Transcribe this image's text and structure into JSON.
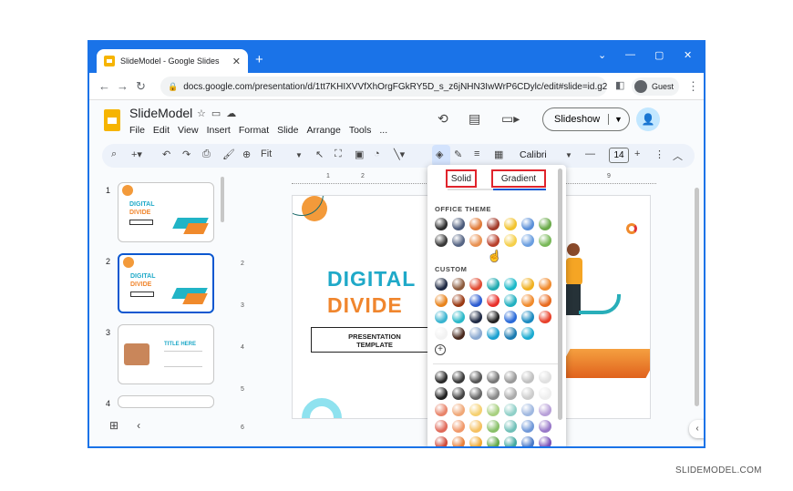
{
  "browser": {
    "tab_title": "SlideModel - Google Slides",
    "url": "docs.google.com/presentation/d/1tt7KHIXVVfXhOrgFGkRY5D_s_z6jNHN3IwWrP6CDylc/edit#slide=id.g2...",
    "profile_label": "Guest"
  },
  "app": {
    "doc_title": "SlideModel",
    "menus": [
      "File",
      "Edit",
      "View",
      "Insert",
      "Format",
      "Slide",
      "Arrange",
      "Tools",
      "..."
    ],
    "slideshow_label": "Slideshow"
  },
  "toolbar": {
    "zoom_label": "Fit",
    "font_name": "Calibri",
    "font_size": "14"
  },
  "filmstrip": {
    "slides": [
      {
        "number": "1",
        "line1": "DIGITAL",
        "line2": "DIVIDE"
      },
      {
        "number": "2",
        "line1": "DIGITAL",
        "line2": "DIVIDE"
      },
      {
        "number": "3",
        "line1": "TITLE HERE",
        "line2": ""
      },
      {
        "number": "4",
        "line1": "",
        "line2": ""
      }
    ]
  },
  "rulers": {
    "top": [
      "1",
      "2",
      "9"
    ],
    "left": [
      "2",
      "3",
      "4",
      "5",
      "6"
    ]
  },
  "slide": {
    "title_line1": "DIGITAL",
    "title_line2": "DIVIDE",
    "subtitle_line1": "PRESENTATION",
    "subtitle_line2": "TEMPLATE"
  },
  "color_panel": {
    "tab_solid": "Solid",
    "tab_gradient": "Gradient",
    "section_theme": "OFFICE THEME",
    "section_custom": "CUSTOM",
    "theme_colors": [
      "#2e2e2e",
      "#4a5a7a",
      "#e07b39",
      "#a33a2a",
      "#f2c32e",
      "#5a8fd8",
      "#6aaa4a",
      "#3a3a3a",
      "#566584",
      "#e89050",
      "#b8402c",
      "#f5cf4a",
      "#6a9ee0",
      "#78b858"
    ],
    "custom_colors": [
      "#1f2a44",
      "#8c5a3c",
      "#e04a32",
      "#20aab0",
      "#1ab8c8",
      "#f0b020",
      "#f08a2c",
      "#e8841e",
      "#9a3a14",
      "#2a5ad0",
      "#e8302a",
      "#22b0c0",
      "#f08a2c",
      "#e86a1e",
      "#3ab4d0",
      "#2ab8c8",
      "#1f2a44",
      "#222222",
      "#2a6ad8",
      "#1a8ac0",
      "#e8402a",
      "#f2f2f2",
      "#4a2a1e",
      "#8aa8d0",
      "#1aa0d0",
      "#1a7ab0",
      "#1aaad0",
      "#ffffff"
    ],
    "gradient_colors": [
      "#2a2a2a",
      "#3a3a3a",
      "#555555",
      "#777777",
      "#999999",
      "#c0c0c0",
      "#e0e0e0",
      "#202020",
      "#444444",
      "#666666",
      "#888888",
      "#aaaaaa",
      "#cccccc",
      "#eeeeee",
      "#e8846a",
      "#f0a878",
      "#f5d070",
      "#a8d080",
      "#90d0c8",
      "#a0b8e0",
      "#b8a0d8",
      "#e06a5a",
      "#f0986a",
      "#f5c060",
      "#88c068",
      "#70c0b8",
      "#7098d8",
      "#9878c8",
      "#d04a3a",
      "#e8803a",
      "#f0a830",
      "#60a848",
      "#40a8a0",
      "#4878c8",
      "#7850b8"
    ]
  },
  "watermark": "SLIDEMODEL.COM"
}
